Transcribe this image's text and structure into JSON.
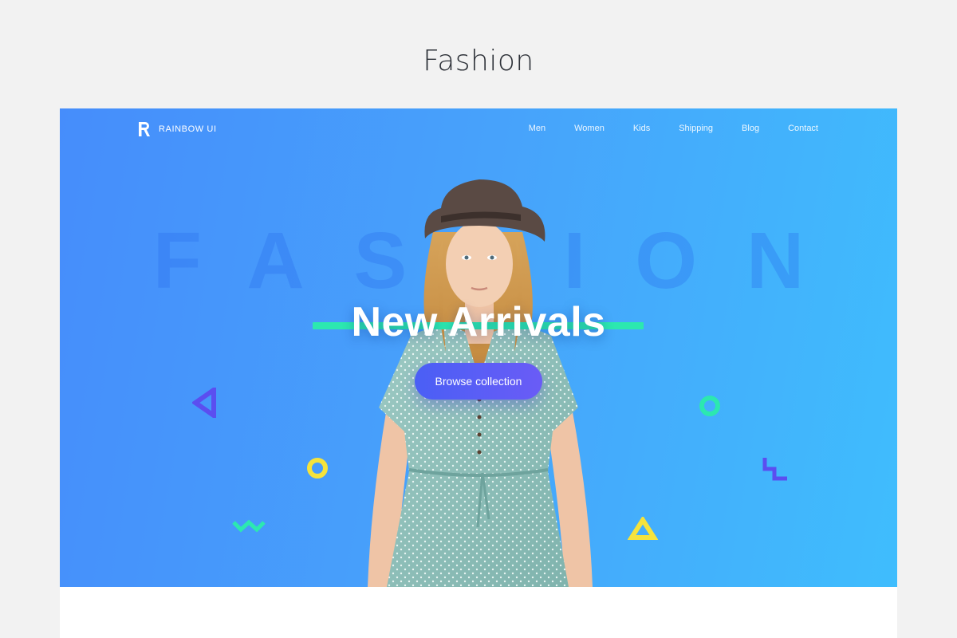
{
  "page": {
    "heading": "Fashion"
  },
  "brand": {
    "name": "RAINBOW UI"
  },
  "nav": {
    "items": [
      {
        "label": "Men"
      },
      {
        "label": "Women"
      },
      {
        "label": "Kids"
      },
      {
        "label": "Shipping"
      },
      {
        "label": "Blog"
      },
      {
        "label": "Contact"
      }
    ]
  },
  "hero": {
    "watermark": "FASHION",
    "headline": "New Arrivals",
    "cta_label": "Browse collection"
  },
  "colors": {
    "gradient_start": "#468dfb",
    "gradient_end": "#3fbdfd",
    "accent_mint": "#2ce8b0",
    "accent_yellow": "#f5e33c",
    "accent_violet": "#5b4ef0",
    "cta_start": "#4a5ff5",
    "cta_end": "#6a5cf6"
  },
  "icons": {
    "logo": "letter-r-logo-icon",
    "decor": [
      "triangle-outline-icon",
      "ring-icon",
      "zigzag-icon",
      "steps-icon"
    ]
  }
}
